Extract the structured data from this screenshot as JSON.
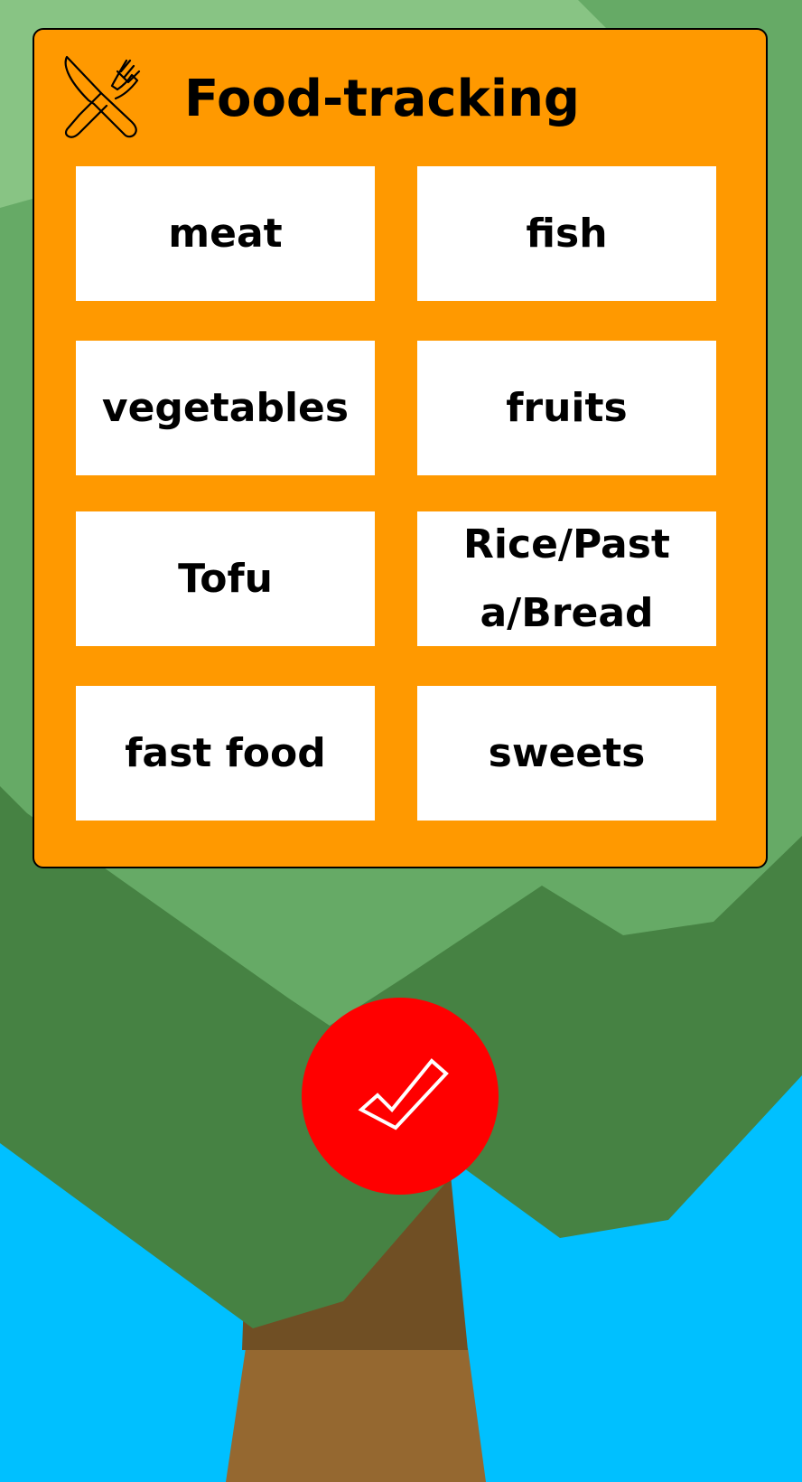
{
  "panel": {
    "title": "Food-tracking",
    "icon": "cutlery-icon"
  },
  "food_buttons": [
    {
      "label": "meat"
    },
    {
      "label": "fish"
    },
    {
      "label": "vegetables"
    },
    {
      "label": "fruits"
    },
    {
      "label": "Tofu"
    },
    {
      "label": "Rice/Pasta/Bread"
    },
    {
      "label": "fast food"
    },
    {
      "label": "sweets"
    }
  ],
  "confirm_button": {
    "icon": "checkmark-icon"
  },
  "colors": {
    "panel": "#ff9900",
    "confirm": "#ff0000",
    "sky": "#00c0ff",
    "foliage_light": "#88c484",
    "foliage_mid": "#66aa66",
    "foliage_dark": "#468243",
    "trunk": "#956830",
    "trunk_shadow": "#704f24"
  }
}
